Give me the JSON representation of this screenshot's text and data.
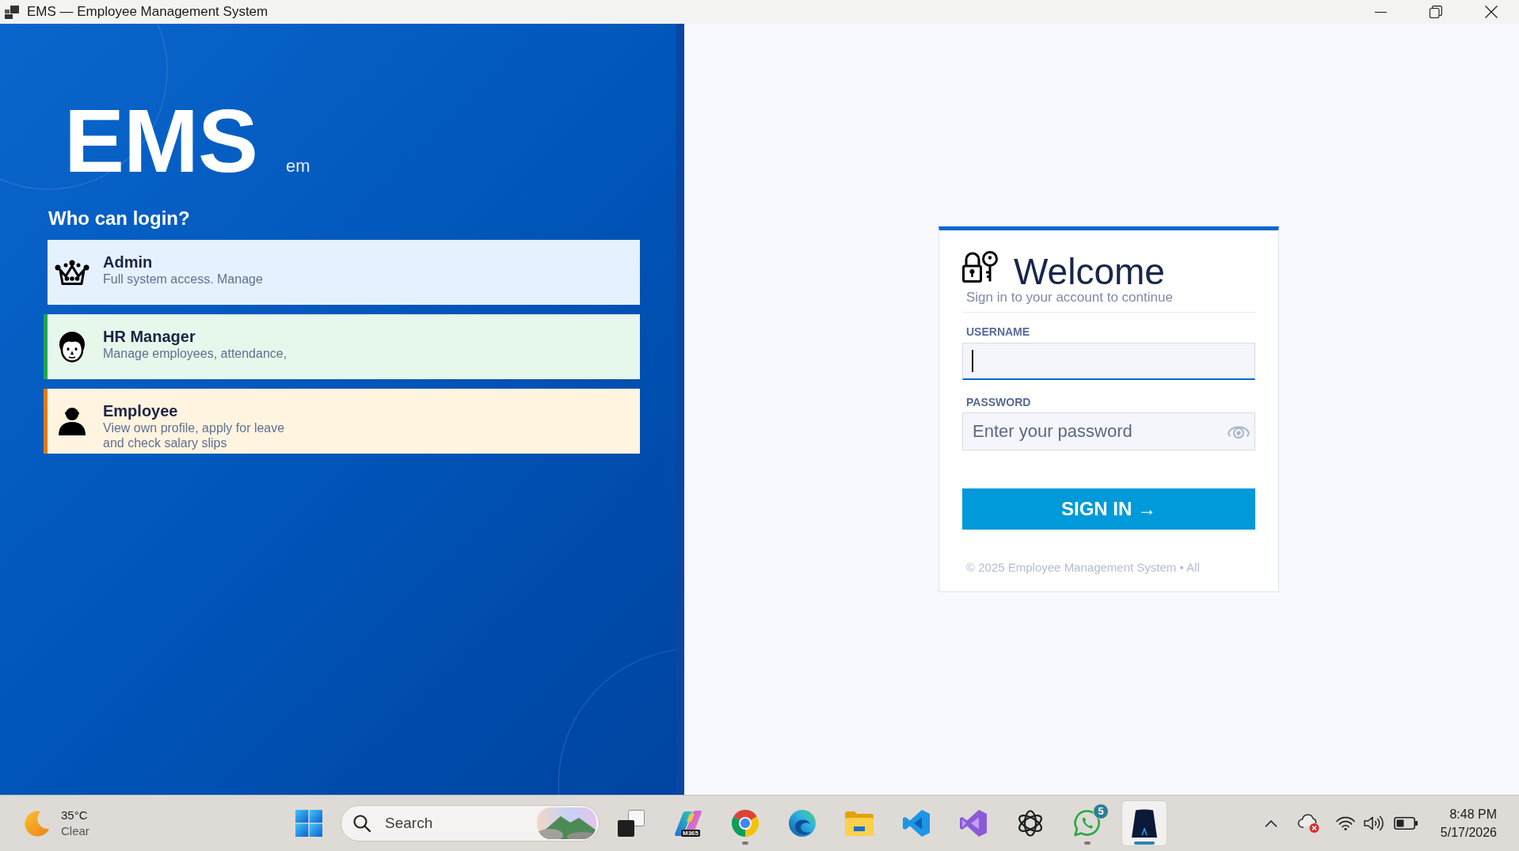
{
  "window": {
    "title": "EMS — Employee Management System"
  },
  "brand": {
    "logo": "EMS",
    "tagline": "em"
  },
  "roles_heading": "Who can login?",
  "roles": [
    {
      "kind": "admin",
      "title": "Admin",
      "description": "Full system access. Manage"
    },
    {
      "kind": "hr",
      "title": "HR Manager",
      "description": "Manage employees, attendance,",
      "color": "#1fa64e"
    },
    {
      "kind": "employee",
      "title": "Employee",
      "description": "View own profile, apply for leave and check salary slips",
      "color": "#e07b12"
    }
  ],
  "login": {
    "heading": "Welcome",
    "subtitle": "Sign in to your account to continue",
    "username": {
      "label": "USERNAME",
      "focused": true
    },
    "password": {
      "label": "PASSWORD",
      "placeholder": "Enter your password",
      "focused": false
    },
    "submit": "SIGN IN →",
    "footer": "© 2025 Employee Management System • All"
  },
  "taskbar": {
    "weather": {
      "temperature": "35°C",
      "condition": "Clear"
    },
    "search": {
      "placeholder": "Search"
    },
    "apps": [
      {
        "kind": "taskview",
        "running": false,
        "selected": false
      },
      {
        "kind": "copilot",
        "label": "M365",
        "running": false,
        "selected": false
      },
      {
        "kind": "chrome",
        "running": true,
        "selected": false
      },
      {
        "kind": "edge",
        "running": false,
        "selected": false
      },
      {
        "kind": "files",
        "running": false,
        "selected": false
      },
      {
        "kind": "vscode",
        "running": false,
        "selected": false
      },
      {
        "kind": "vstudio",
        "running": false,
        "selected": false
      },
      {
        "kind": "chatgpt",
        "running": false,
        "selected": false
      },
      {
        "kind": "whatsapp",
        "badge": "5",
        "running": true,
        "selected": false
      },
      {
        "kind": "ems",
        "running": true,
        "selected": true
      }
    ],
    "clock": {
      "time": "8:48 PM",
      "date": "5/17/2026"
    }
  }
}
